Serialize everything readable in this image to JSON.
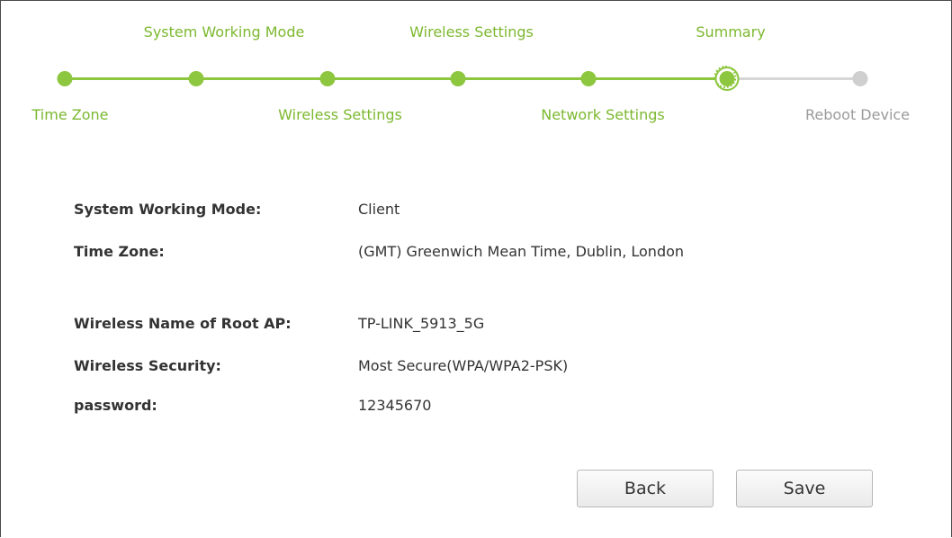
{
  "wizard": {
    "steps_top": [
      {
        "label": "System Working Mode"
      },
      {
        "label": "Wireless Settings"
      },
      {
        "label": "Summary"
      }
    ],
    "steps_bottom": [
      {
        "label": "Time Zone"
      },
      {
        "label": "Wireless Settings"
      },
      {
        "label": "Network Settings"
      },
      {
        "label": "Reboot Device"
      }
    ],
    "current_step": 6,
    "total_steps": 7
  },
  "summary": {
    "working_mode": {
      "label": "System Working Mode:",
      "value": "Client"
    },
    "time_zone": {
      "label": "Time Zone:",
      "value": "(GMT) Greenwich Mean Time, Dublin, London"
    },
    "root_ap": {
      "label": "Wireless Name of Root AP:",
      "value": "TP-LINK_5913_5G"
    },
    "security": {
      "label": "Wireless Security:",
      "value": "Most Secure(WPA/WPA2-PSK)"
    },
    "password": {
      "label": "password:",
      "value": "12345670"
    }
  },
  "buttons": {
    "back": "Back",
    "save": "Save"
  },
  "colors": {
    "accent": "#8dc63f",
    "pending": "#cfcfcf"
  }
}
